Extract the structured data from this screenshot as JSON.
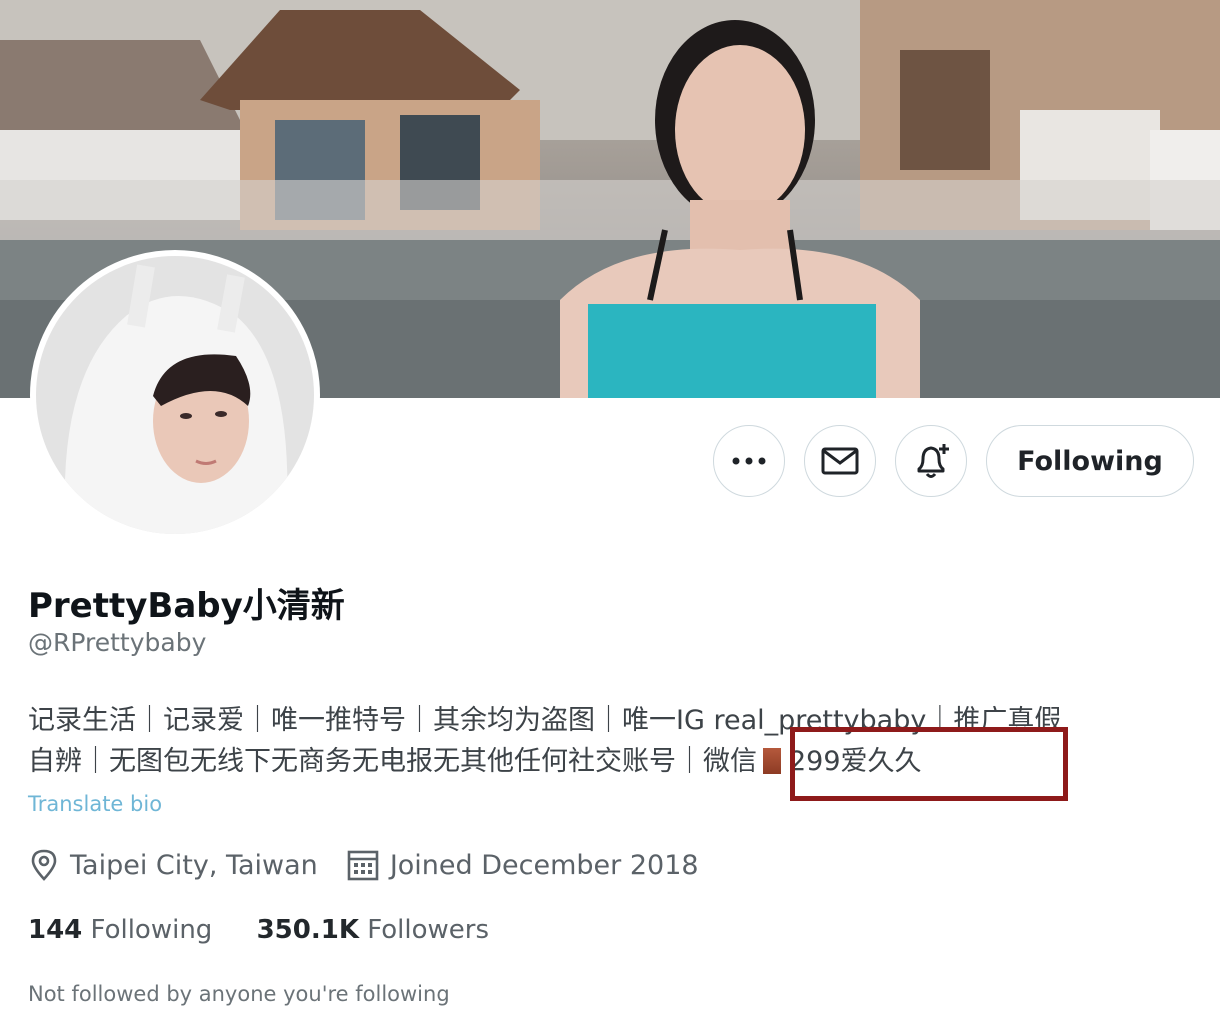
{
  "profile": {
    "display_name": "PrettyBaby小清新",
    "handle": "@RPrettybaby",
    "bio_line1": "记录生活｜记录爱｜唯一推特号｜其余均为盗图｜唯一IG real_prettybaby｜推广真假",
    "bio_line2_main": "自辨｜无图包无线下无商务无电报无其他任何社交账号｜",
    "bio_highlight_a": "微信",
    "bio_highlight_b": "299爱久久",
    "translate_label": "Translate bio",
    "location": "Taipei City, Taiwan",
    "joined": "Joined December 2018",
    "following_count": "144",
    "following_label": "Following",
    "followers_count": "350.1K",
    "followers_label": "Followers",
    "not_followed": "Not followed by anyone you're following"
  },
  "actions": {
    "follow_state_label": "Following",
    "more_icon": "more-icon",
    "message_icon": "envelope-icon",
    "notify_icon": "bell-plus-icon"
  },
  "colors": {
    "highlight_border": "#8e1a1a",
    "censor_block": "#2bb5c0",
    "translate_link": "#6fb6d6"
  }
}
